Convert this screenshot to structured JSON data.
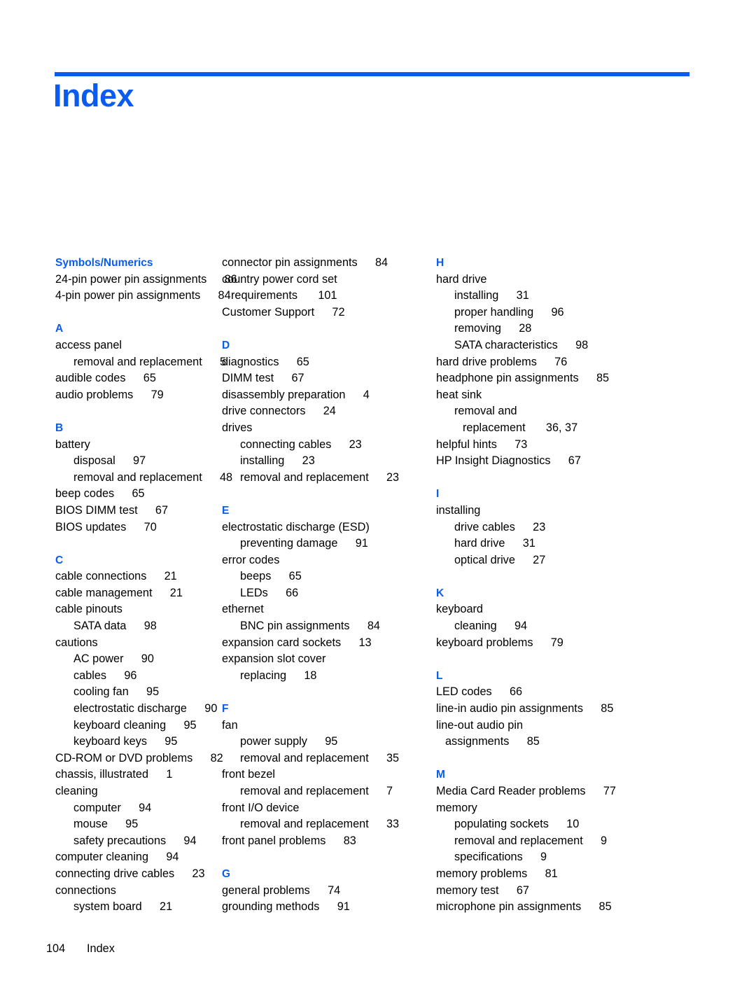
{
  "document": {
    "title": "Index",
    "accent_color": "#0a5cf0",
    "text_color": "#000000",
    "background_color": "#ffffff"
  },
  "footer": {
    "page_number": "104",
    "label": "Index"
  },
  "columns": [
    {
      "id": "column-1",
      "groups": [
        {
          "letter": "Symbols/Numerics",
          "entries": [
            {
              "level": 1,
              "text": "24-pin power pin assignments",
              "page": "86"
            },
            {
              "level": 1,
              "text": "4-pin power pin assignments",
              "page": "84"
            }
          ]
        },
        {
          "letter": "A",
          "entries": [
            {
              "level": 1,
              "text": "access panel",
              "page": ""
            },
            {
              "level": 2,
              "text": "removal and replacement",
              "page": "5"
            },
            {
              "level": 1,
              "text": "audible codes",
              "page": "65"
            },
            {
              "level": 1,
              "text": "audio problems",
              "page": "79"
            }
          ]
        },
        {
          "letter": "B",
          "entries": [
            {
              "level": 1,
              "text": "battery",
              "page": ""
            },
            {
              "level": 2,
              "text": "disposal",
              "page": "97"
            },
            {
              "level": 2,
              "text": "removal and replacement",
              "page": "48"
            },
            {
              "level": 1,
              "text": "beep codes",
              "page": "65"
            },
            {
              "level": 1,
              "text": "BIOS DIMM test",
              "page": "67"
            },
            {
              "level": 1,
              "text": "BIOS updates",
              "page": "70"
            }
          ]
        },
        {
          "letter": "C",
          "entries": [
            {
              "level": 1,
              "text": "cable connections",
              "page": "21"
            },
            {
              "level": 1,
              "text": "cable management",
              "page": "21"
            },
            {
              "level": 1,
              "text": "cable pinouts",
              "page": ""
            },
            {
              "level": 2,
              "text": "SATA data",
              "page": "98"
            },
            {
              "level": 1,
              "text": "cautions",
              "page": ""
            },
            {
              "level": 2,
              "text": "AC power",
              "page": "90"
            },
            {
              "level": 2,
              "text": "cables",
              "page": "96"
            },
            {
              "level": 2,
              "text": "cooling fan",
              "page": "95"
            },
            {
              "level": 2,
              "text": "electrostatic discharge",
              "page": "90"
            },
            {
              "level": 2,
              "text": "keyboard cleaning",
              "page": "95"
            },
            {
              "level": 2,
              "text": "keyboard keys",
              "page": "95"
            },
            {
              "level": 1,
              "text": "CD-ROM or DVD problems",
              "page": "82"
            },
            {
              "level": 1,
              "text": "chassis, illustrated",
              "page": "1"
            },
            {
              "level": 1,
              "text": "cleaning",
              "page": ""
            },
            {
              "level": 2,
              "text": "computer",
              "page": "94"
            },
            {
              "level": 2,
              "text": "mouse",
              "page": "95"
            },
            {
              "level": 2,
              "text": "safety precautions",
              "page": "94"
            },
            {
              "level": 1,
              "text": "computer cleaning",
              "page": "94"
            },
            {
              "level": 1,
              "text": "connecting drive cables",
              "page": "23"
            },
            {
              "level": 1,
              "text": "connections",
              "page": ""
            },
            {
              "level": 2,
              "text": "system board",
              "page": "21"
            }
          ]
        }
      ]
    },
    {
      "id": "column-2",
      "groups": [
        {
          "letter": "",
          "entries": [
            {
              "level": 1,
              "text": "connector pin assignments",
              "page": "84"
            },
            {
              "level": 1,
              "text": "country power cord set",
              "page": ""
            },
            {
              "level": "wrap",
              "text": "requirements",
              "page": "101"
            },
            {
              "level": 1,
              "text": "Customer Support",
              "page": "72"
            }
          ]
        },
        {
          "letter": "D",
          "entries": [
            {
              "level": 1,
              "text": "diagnostics",
              "page": "65"
            },
            {
              "level": 1,
              "text": "DIMM test",
              "page": "67"
            },
            {
              "level": 1,
              "text": "disassembly preparation",
              "page": "4"
            },
            {
              "level": 1,
              "text": "drive connectors",
              "page": "24"
            },
            {
              "level": 1,
              "text": "drives",
              "page": ""
            },
            {
              "level": 2,
              "text": "connecting cables",
              "page": "23"
            },
            {
              "level": 2,
              "text": "installing",
              "page": "23"
            },
            {
              "level": 2,
              "text": "removal and replacement",
              "page": "23"
            }
          ]
        },
        {
          "letter": "E",
          "entries": [
            {
              "level": 1,
              "text": "electrostatic discharge (ESD)",
              "page": ""
            },
            {
              "level": 2,
              "text": "preventing damage",
              "page": "91"
            },
            {
              "level": 1,
              "text": "error codes",
              "page": ""
            },
            {
              "level": 2,
              "text": "beeps",
              "page": "65"
            },
            {
              "level": 2,
              "text": "LEDs",
              "page": "66"
            },
            {
              "level": 1,
              "text": "ethernet",
              "page": ""
            },
            {
              "level": 2,
              "text": "BNC pin assignments",
              "page": "84"
            },
            {
              "level": 1,
              "text": "expansion card sockets",
              "page": "13"
            },
            {
              "level": 1,
              "text": "expansion slot cover",
              "page": ""
            },
            {
              "level": 2,
              "text": "replacing",
              "page": "18"
            }
          ]
        },
        {
          "letter": "F",
          "entries": [
            {
              "level": 1,
              "text": "fan",
              "page": ""
            },
            {
              "level": 2,
              "text": "power supply",
              "page": "95"
            },
            {
              "level": 2,
              "text": "removal and replacement",
              "page": "35"
            },
            {
              "level": 1,
              "text": "front bezel",
              "page": ""
            },
            {
              "level": 2,
              "text": "removal and replacement",
              "page": "7"
            },
            {
              "level": 1,
              "text": "front I/O device",
              "page": ""
            },
            {
              "level": 2,
              "text": "removal and replacement",
              "page": "33"
            },
            {
              "level": 1,
              "text": "front panel problems",
              "page": "83"
            }
          ]
        },
        {
          "letter": "G",
          "entries": [
            {
              "level": 1,
              "text": "general problems",
              "page": "74"
            },
            {
              "level": 1,
              "text": "grounding methods",
              "page": "91"
            }
          ]
        }
      ]
    },
    {
      "id": "column-3",
      "groups": [
        {
          "letter": "H",
          "entries": [
            {
              "level": 1,
              "text": "hard drive",
              "page": ""
            },
            {
              "level": 2,
              "text": "installing",
              "page": "31"
            },
            {
              "level": 2,
              "text": "proper handling",
              "page": "96"
            },
            {
              "level": 2,
              "text": "removing",
              "page": "28"
            },
            {
              "level": 2,
              "text": "SATA characteristics",
              "page": "98"
            },
            {
              "level": 1,
              "text": "hard drive problems",
              "page": "76"
            },
            {
              "level": 1,
              "text": "headphone pin assignments",
              "page": "85"
            },
            {
              "level": 1,
              "text": "heat sink",
              "page": ""
            },
            {
              "level": 2,
              "text": "removal and",
              "page": ""
            },
            {
              "level": "wrap2",
              "text": "replacement",
              "page": "36, 37"
            },
            {
              "level": 1,
              "text": "helpful hints",
              "page": "73"
            },
            {
              "level": 1,
              "text": "HP Insight Diagnostics",
              "page": "67"
            }
          ]
        },
        {
          "letter": "I",
          "entries": [
            {
              "level": 1,
              "text": "installing",
              "page": ""
            },
            {
              "level": 2,
              "text": "drive cables",
              "page": "23"
            },
            {
              "level": 2,
              "text": "hard drive",
              "page": "31"
            },
            {
              "level": 2,
              "text": "optical drive",
              "page": "27"
            }
          ]
        },
        {
          "letter": "K",
          "entries": [
            {
              "level": 1,
              "text": "keyboard",
              "page": ""
            },
            {
              "level": 2,
              "text": "cleaning",
              "page": "94"
            },
            {
              "level": 1,
              "text": "keyboard problems",
              "page": "79"
            }
          ]
        },
        {
          "letter": "L",
          "entries": [
            {
              "level": 1,
              "text": "LED codes",
              "page": "66"
            },
            {
              "level": 1,
              "text": "line-in audio pin assignments",
              "page": "85"
            },
            {
              "level": 1,
              "text": "line-out audio pin",
              "page": ""
            },
            {
              "level": "wrap",
              "text": "assignments",
              "page": "85"
            }
          ]
        },
        {
          "letter": "M",
          "entries": [
            {
              "level": 1,
              "text": "Media Card Reader problems",
              "page": "77"
            },
            {
              "level": 1,
              "text": "memory",
              "page": ""
            },
            {
              "level": 2,
              "text": "populating sockets",
              "page": "10"
            },
            {
              "level": 2,
              "text": "removal and replacement",
              "page": "9"
            },
            {
              "level": 2,
              "text": "specifications",
              "page": "9"
            },
            {
              "level": 1,
              "text": "memory problems",
              "page": "81"
            },
            {
              "level": 1,
              "text": "memory test",
              "page": "67"
            },
            {
              "level": 1,
              "text": "microphone pin assignments",
              "page": "85"
            }
          ]
        }
      ]
    }
  ]
}
